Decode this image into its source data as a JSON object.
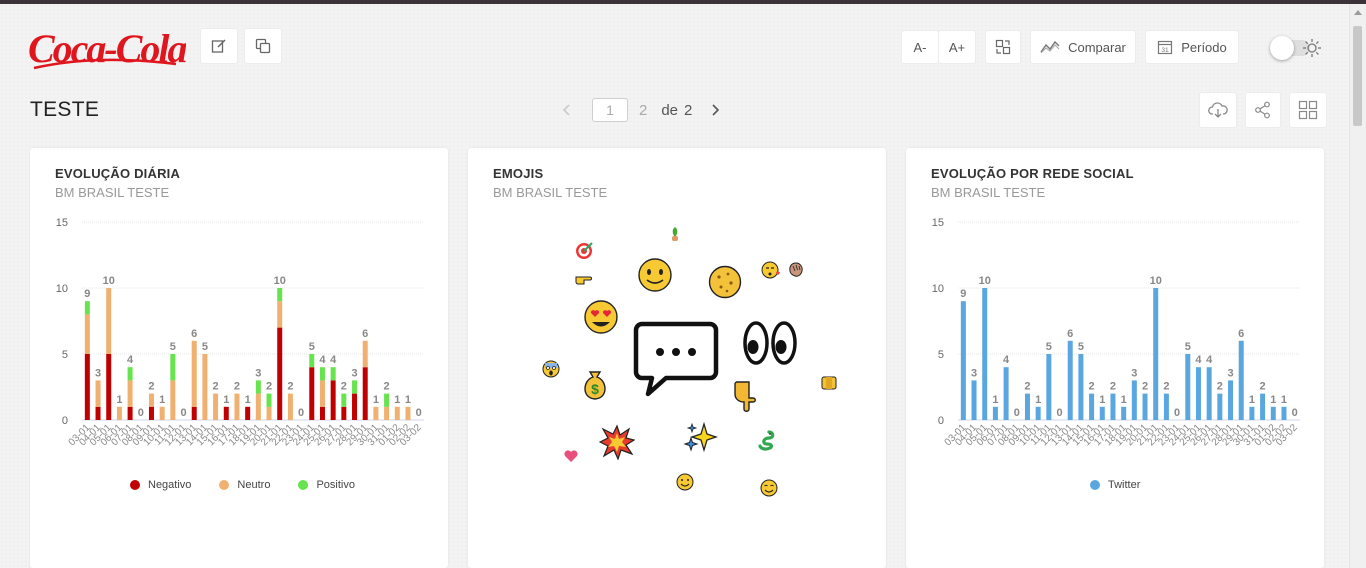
{
  "brand": {
    "logo_text": "Coca-Cola",
    "color": "#e0161f"
  },
  "toolbar": {
    "font_decrease": "A-",
    "font_increase": "A+",
    "compare_label": "Comparar",
    "period_label": "Período",
    "calendar_day": "31"
  },
  "page": {
    "title": "TESTE"
  },
  "pager": {
    "current": "1",
    "next": "2",
    "of_label": "de",
    "total": "2"
  },
  "colors": {
    "negativo": "#c00000",
    "neutro": "#f0b070",
    "positivo": "#66e34d",
    "twitter": "#5aa7e0"
  },
  "cards": [
    {
      "title": "EVOLUÇÃO DIÁRIA",
      "subtitle": "BM BRASIL TESTE",
      "legend": [
        "Negativo",
        "Neutro",
        "Positivo"
      ]
    },
    {
      "title": "EMOJIS",
      "subtitle": "BM BRASIL TESTE",
      "emojis": [
        "target-emoji",
        "hand-with-plant-emoji",
        "slightly-smiling-face-emoji",
        "cookie-emoji",
        "face-blowing-kiss-emoji",
        "waving-hand-emoji",
        "pointing-right-emoji",
        "heart-eyes-emoji",
        "speech-bubble-emoji",
        "eyes-emoji",
        "screaming-face-emoji",
        "money-bag-emoji",
        "pointing-down-emoji",
        "cheese-emoji",
        "collision-emoji",
        "sparkles-emoji",
        "snake-emoji",
        "pink-heart-emoji",
        "smiling-face-emoji",
        "blushing-face-emoji"
      ]
    },
    {
      "title": "EVOLUÇÃO POR REDE SOCIAL",
      "subtitle": "BM BRASIL TESTE",
      "legend": [
        "Twitter"
      ]
    }
  ],
  "chart_data": [
    {
      "type": "bar",
      "stacked": true,
      "categories": [
        "03-01",
        "04-01",
        "05-01",
        "06-01",
        "07-01",
        "08-01",
        "09-01",
        "10-01",
        "11-01",
        "12-01",
        "13-01",
        "14-01",
        "15-01",
        "16-01",
        "17-01",
        "18-01",
        "19-01",
        "20-01",
        "21-01",
        "22-01",
        "23-01",
        "24-01",
        "25-01",
        "26-01",
        "27-01",
        "28-01",
        "29-01",
        "30-01",
        "31-01",
        "01-02",
        "02-02",
        "03-02"
      ],
      "series": [
        {
          "name": "Negativo",
          "values": [
            5,
            1,
            5,
            0,
            1,
            0,
            1,
            0,
            0,
            0,
            1,
            0,
            0,
            1,
            0,
            1,
            0,
            0,
            7,
            0,
            0,
            4,
            1,
            3,
            1,
            2,
            4,
            0,
            0,
            0,
            0,
            0
          ]
        },
        {
          "name": "Neutro",
          "values": [
            3,
            2,
            5,
            1,
            2,
            0,
            1,
            1,
            3,
            0,
            5,
            5,
            2,
            0,
            2,
            0,
            2,
            1,
            2,
            2,
            0,
            0,
            2,
            0,
            0,
            0,
            2,
            1,
            1,
            1,
            1,
            0
          ]
        },
        {
          "name": "Positivo",
          "values": [
            1,
            0,
            0,
            0,
            1,
            0,
            0,
            0,
            2,
            0,
            0,
            0,
            0,
            0,
            0,
            0,
            1,
            1,
            1,
            0,
            0,
            1,
            1,
            1,
            1,
            1,
            0,
            0,
            1,
            0,
            0,
            0
          ]
        }
      ],
      "totals": [
        9,
        3,
        10,
        1,
        4,
        0,
        2,
        1,
        5,
        0,
        6,
        5,
        2,
        1,
        2,
        1,
        3,
        2,
        10,
        2,
        0,
        5,
        4,
        4,
        2,
        3,
        6,
        1,
        2,
        1,
        1,
        0
      ],
      "yticks": [
        0,
        5,
        10,
        15
      ],
      "ylim": [
        0,
        15
      ],
      "legend_position": "bottom",
      "grid": true
    },
    {
      "type": "bar",
      "categories": [
        "03-01",
        "04-01",
        "05-01",
        "06-01",
        "07-01",
        "08-01",
        "09-01",
        "10-01",
        "11-01",
        "12-01",
        "13-01",
        "14-01",
        "15-01",
        "16-01",
        "17-01",
        "18-01",
        "19-01",
        "20-01",
        "21-01",
        "22-01",
        "23-01",
        "24-01",
        "25-01",
        "26-01",
        "27-01",
        "28-01",
        "29-01",
        "30-01",
        "31-01",
        "01-02",
        "02-02",
        "03-02"
      ],
      "series": [
        {
          "name": "Twitter",
          "values": [
            9,
            3,
            10,
            1,
            4,
            0,
            2,
            1,
            5,
            0,
            6,
            5,
            2,
            1,
            2,
            1,
            3,
            2,
            10,
            2,
            0,
            5,
            4,
            4,
            2,
            3,
            6,
            1,
            2,
            1,
            1,
            0
          ]
        }
      ],
      "yticks": [
        0,
        5,
        10,
        15
      ],
      "ylim": [
        0,
        15
      ],
      "legend_position": "bottom",
      "grid": true
    }
  ]
}
